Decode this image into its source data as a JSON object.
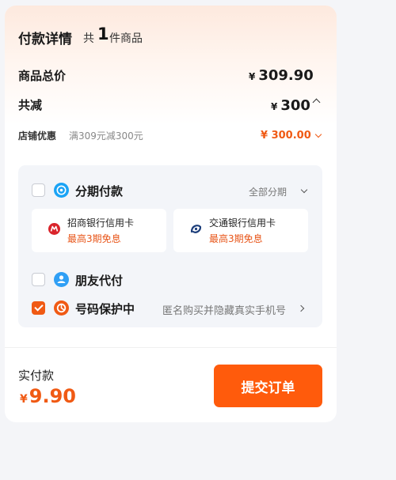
{
  "header": {
    "title": "付款详情",
    "count_prefix": "共",
    "count": "1",
    "count_suffix": "件商品"
  },
  "summary": {
    "total_label": "商品总价",
    "total_currency": "¥",
    "total_value": "309.90",
    "discount_label": "共减",
    "discount_currency": "¥",
    "discount_value": "300"
  },
  "shop_discount": {
    "label": "店铺优惠",
    "description": "满309元减300元",
    "amount": "¥ 300.00"
  },
  "payment_options": {
    "installment": {
      "label": "分期付款",
      "checked": false,
      "action_label": "全部分期",
      "icon": "installment-icon",
      "banks": [
        {
          "name": "招商银行信用卡",
          "promo": "最高3期免息",
          "icon": "cmb-logo-icon"
        },
        {
          "name": "交通银行信用卡",
          "promo": "最高3期免息",
          "icon": "bocom-logo-icon"
        }
      ]
    },
    "friend_pay": {
      "label": "朋友代付",
      "checked": false,
      "icon": "friend-pay-icon"
    },
    "number_protection": {
      "label": "号码保护中",
      "checked": true,
      "description": "匿名购买并隐藏真实手机号",
      "icon": "privacy-icon"
    }
  },
  "footer": {
    "pay_label": "实付款",
    "pay_currency": "¥",
    "pay_value": "9.90",
    "submit_label": "提交订单"
  },
  "colors": {
    "accent": "#ff5b0c",
    "accent_text": "#f05a14",
    "installment_icon": "#1aa3f5",
    "friend_icon": "#2f9ff5",
    "cmb_red": "#d9242b",
    "bocom_blue": "#1b3d7a"
  }
}
